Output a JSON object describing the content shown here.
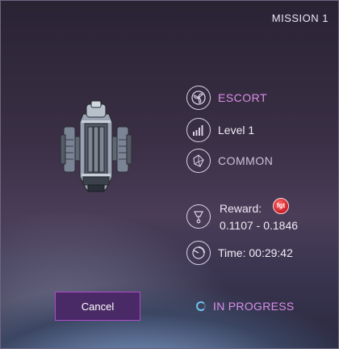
{
  "header": {
    "mission": "MISSION 1"
  },
  "mission_info": {
    "type_label": "ESCORT",
    "level_label": "Level 1",
    "rarity_label": "COMMON",
    "reward_label": "Reward:",
    "reward_token": "fgt",
    "reward_range": "0.1107 - 0.1846",
    "time_label": "Time: 00:29:42"
  },
  "actions": {
    "cancel_label": "Cancel"
  },
  "status": {
    "label": "IN PROGRESS"
  },
  "icons": {
    "type": "fan-icon",
    "level": "level-bars-icon",
    "rarity": "crystal-icon",
    "reward": "trophy-icon",
    "time": "timer-icon",
    "status": "spinner-icon"
  },
  "colors": {
    "accent": "#d98ee8",
    "button": "#4a2a66",
    "button_border": "#b04ac8",
    "spinner": "#6fc6ee"
  }
}
